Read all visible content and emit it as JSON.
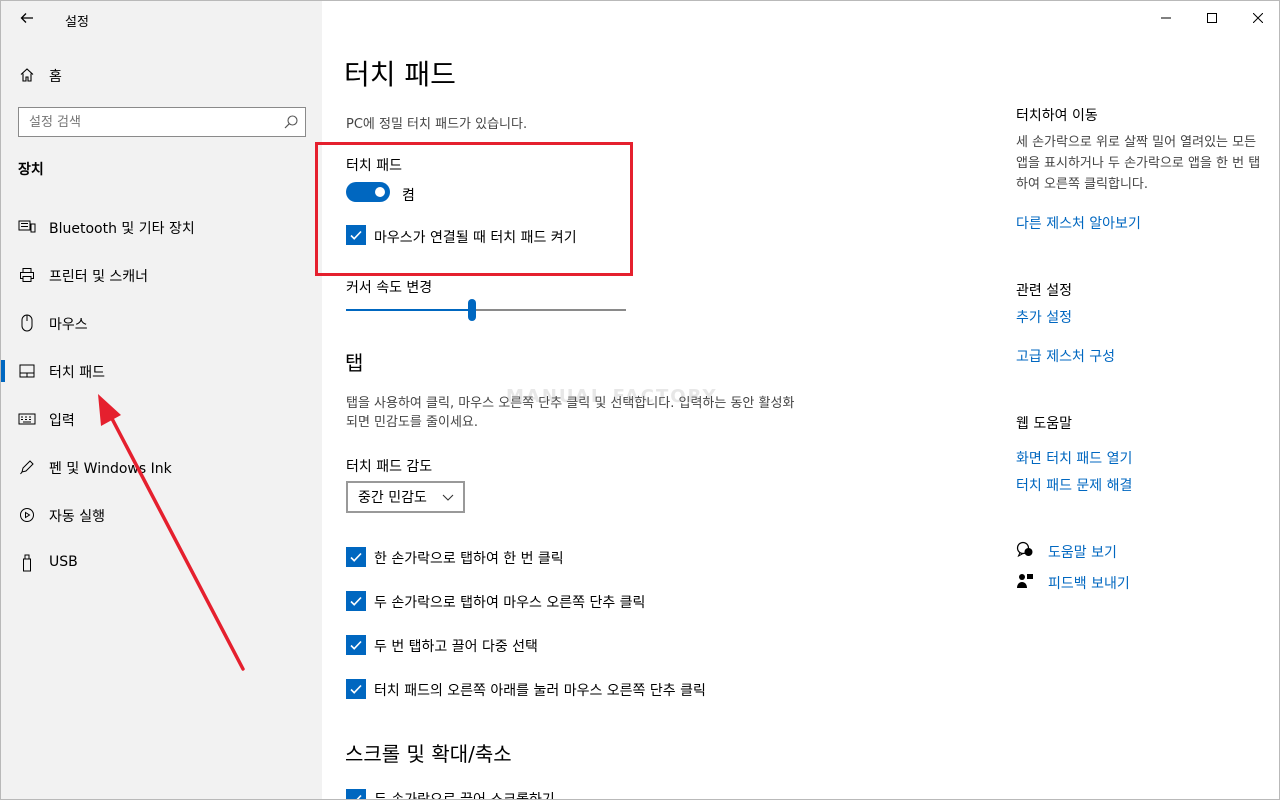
{
  "app": {
    "title": "설정"
  },
  "sidebar": {
    "home_label": "홈",
    "search_placeholder": "설정 검색",
    "section_title": "장치",
    "items": [
      {
        "label": "Bluetooth 및 기타 장치",
        "icon": "bluetooth-devices-icon"
      },
      {
        "label": "프린터 및 스캐너",
        "icon": "printer-icon"
      },
      {
        "label": "마우스",
        "icon": "mouse-icon"
      },
      {
        "label": "터치 패드",
        "icon": "touchpad-icon",
        "active": true
      },
      {
        "label": "입력",
        "icon": "keyboard-icon"
      },
      {
        "label": "펜 및 Windows Ink",
        "icon": "pen-icon"
      },
      {
        "label": "자동 실행",
        "icon": "autoplay-icon"
      },
      {
        "label": "USB",
        "icon": "usb-icon"
      }
    ]
  },
  "main": {
    "title": "터치 패드",
    "subtitle": "PC에 정밀 터치 패드가 있습니다.",
    "touchpad_label": "터치 패드",
    "toggle_state": "켬",
    "toggle_on": true,
    "mouse_connected_label": "마우스가 연결될 때 터치 패드 켜기",
    "cursor_speed_label": "커서 속도 변경",
    "cursor_speed_level": 0.45,
    "tap_heading": "탭",
    "tap_description": "탭을 사용하여 클릭, 마우스 오른쪽 단추 클릭 및 선택합니다. 입력하는 동안 활성화되면 민감도를 줄이세요.",
    "sensitivity_label": "터치 패드 감도",
    "sensitivity_value": "중간 민감도",
    "tap_options": [
      "한 손가락으로 탭하여 한 번 클릭",
      "두 손가락으로 탭하여 마우스 오른쪽 단추 클릭",
      "두 번 탭하고 끌어 다중 선택",
      "터치 패드의 오른쪽 아래를 눌러 마우스 오른쪽 단추 클릭"
    ],
    "scroll_heading": "스크롤 및 확대/축소",
    "scroll_option": "두 손가락으로 끌어 스크롤하기"
  },
  "aside": {
    "swipe_title": "터치하여 이동",
    "swipe_text": "세 손가락으로 위로 살짝 밀어 열려있는 모든 앱을 표시하거나 두 손가락으로 앱을 한 번 탭하여 오른쪽 클릭합니다.",
    "swipe_link": "다른 제스처 알아보기",
    "related_title": "관련 설정",
    "related_links": [
      "추가 설정",
      "고급 제스처 구성"
    ],
    "help_title": "웹 도움말",
    "help_links": [
      "화면 터치 패드 열기",
      "터치 패드 문제 해결"
    ],
    "get_help": "도움말 보기",
    "feedback": "피드백 보내기"
  },
  "watermark": "MANUAL FACTORY",
  "colors": {
    "accent": "#0067c0",
    "annotation": "#e5202e",
    "sidebar_bg": "#f2f2f2"
  }
}
